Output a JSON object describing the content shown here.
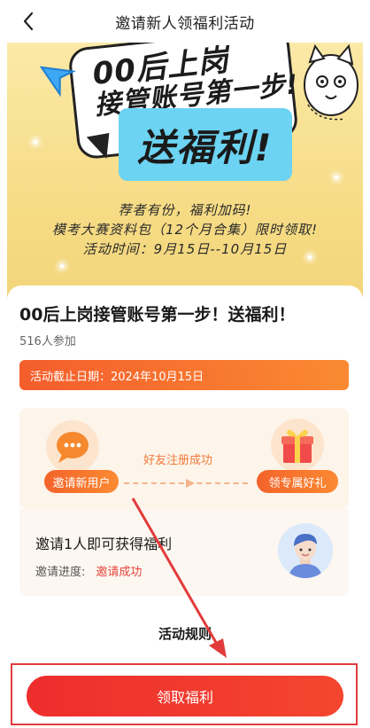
{
  "header": {
    "back_label": "",
    "title": "邀请新人领福利活动"
  },
  "banner": {
    "headline_line1": "00后上岗",
    "headline_line2": "接管账号第一步!",
    "gift_text": "送福利!",
    "promo_line1": "荐者有份，福利加码!",
    "promo_line2": "模考大赛资料包（12个月合集）限时领取!",
    "promo_line3": "活动时间：9月15日--10月15日",
    "colors": {
      "background": "#f6dc86",
      "gift_box": "#6cd3f2"
    }
  },
  "activity": {
    "title": "00后上岗接管账号第一步！送福利！",
    "participants": "516人参加",
    "deadline": "活动截止日期：2024年10月15日"
  },
  "steps": {
    "invite_label": "邀请新用户",
    "middle_text": "好友注册成功",
    "reward_label": "领专属好礼"
  },
  "progress": {
    "title": "邀请1人即可获得福利",
    "label": "邀请进度:",
    "status": "邀请成功"
  },
  "rules": {
    "title": "活动规则"
  },
  "footer": {
    "claim_button": "领取福利",
    "accent_color": "#ee2d2d"
  }
}
